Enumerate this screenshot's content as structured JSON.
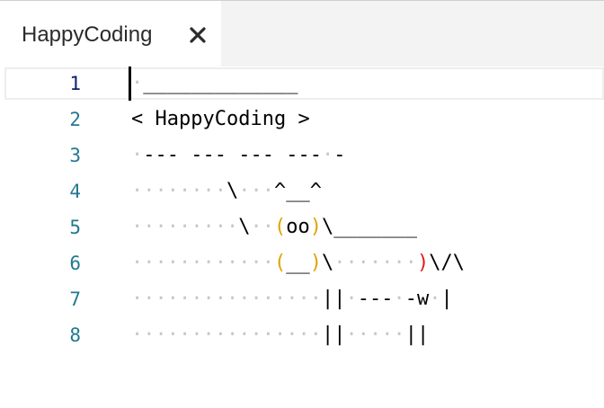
{
  "tab": {
    "title": "HappyCoding",
    "close_icon": "close-icon"
  },
  "editor": {
    "line_numbers": [
      "1",
      "2",
      "3",
      "4",
      "5",
      "6",
      "7",
      "8"
    ],
    "active_line": "1",
    "lines": [
      "·_____________",
      "< HappyCoding >",
      "·--- --- --- ---·-",
      "········\\···^__^",
      "·········\\··(oo)\\_______",
      "············(__)\\·······)\\/\\",
      "················||·---·-w·|",
      "················||·····||"
    ],
    "colors": {
      "whitespace_dot": "#c8c8c8",
      "bracket_level1": "#e0a400",
      "bracket_level2": "#e01b1b",
      "line_number": "#237893",
      "active_line_number": "#0b216f"
    }
  }
}
